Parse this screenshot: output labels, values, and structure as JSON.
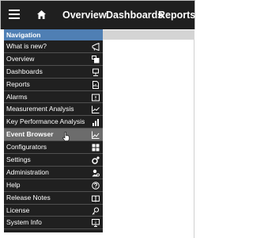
{
  "header": {
    "menu_icon": "hamburger-menu-icon",
    "home_icon": "home-icon",
    "nav": [
      {
        "label": "Overview"
      },
      {
        "label": "Dashboards"
      },
      {
        "label": "Reports"
      }
    ]
  },
  "sidebar": {
    "header": "Navigation",
    "items": [
      {
        "label": "What is new?",
        "icon": "megaphone-icon"
      },
      {
        "label": "Overview",
        "icon": "overview-icon"
      },
      {
        "label": "Dashboards",
        "icon": "dashboard-icon"
      },
      {
        "label": "Reports",
        "icon": "report-icon"
      },
      {
        "label": "Alarms",
        "icon": "alarm-icon"
      },
      {
        "label": "Measurement Analysis",
        "icon": "line-chart-icon"
      },
      {
        "label": "Key Performance Analysis",
        "icon": "bar-chart-icon"
      },
      {
        "label": "Event Browser",
        "icon": "event-chart-icon",
        "active": true
      },
      {
        "label": "Configurators",
        "icon": "configurator-icon"
      },
      {
        "label": "Settings",
        "icon": "gear-icon"
      },
      {
        "label": "Administration",
        "icon": "user-admin-icon"
      },
      {
        "label": "Help",
        "icon": "help-icon"
      },
      {
        "label": "Release Notes",
        "icon": "book-icon"
      },
      {
        "label": "License",
        "icon": "license-icon"
      },
      {
        "label": "System Info",
        "icon": "system-info-icon"
      }
    ]
  },
  "colors": {
    "topbar": "#1f1f1f",
    "sidebar_bg": "#202020",
    "sidebar_header": "#4f7fb4",
    "active_item": "#6c6c6c",
    "content_strip": "#d4d4d4"
  }
}
